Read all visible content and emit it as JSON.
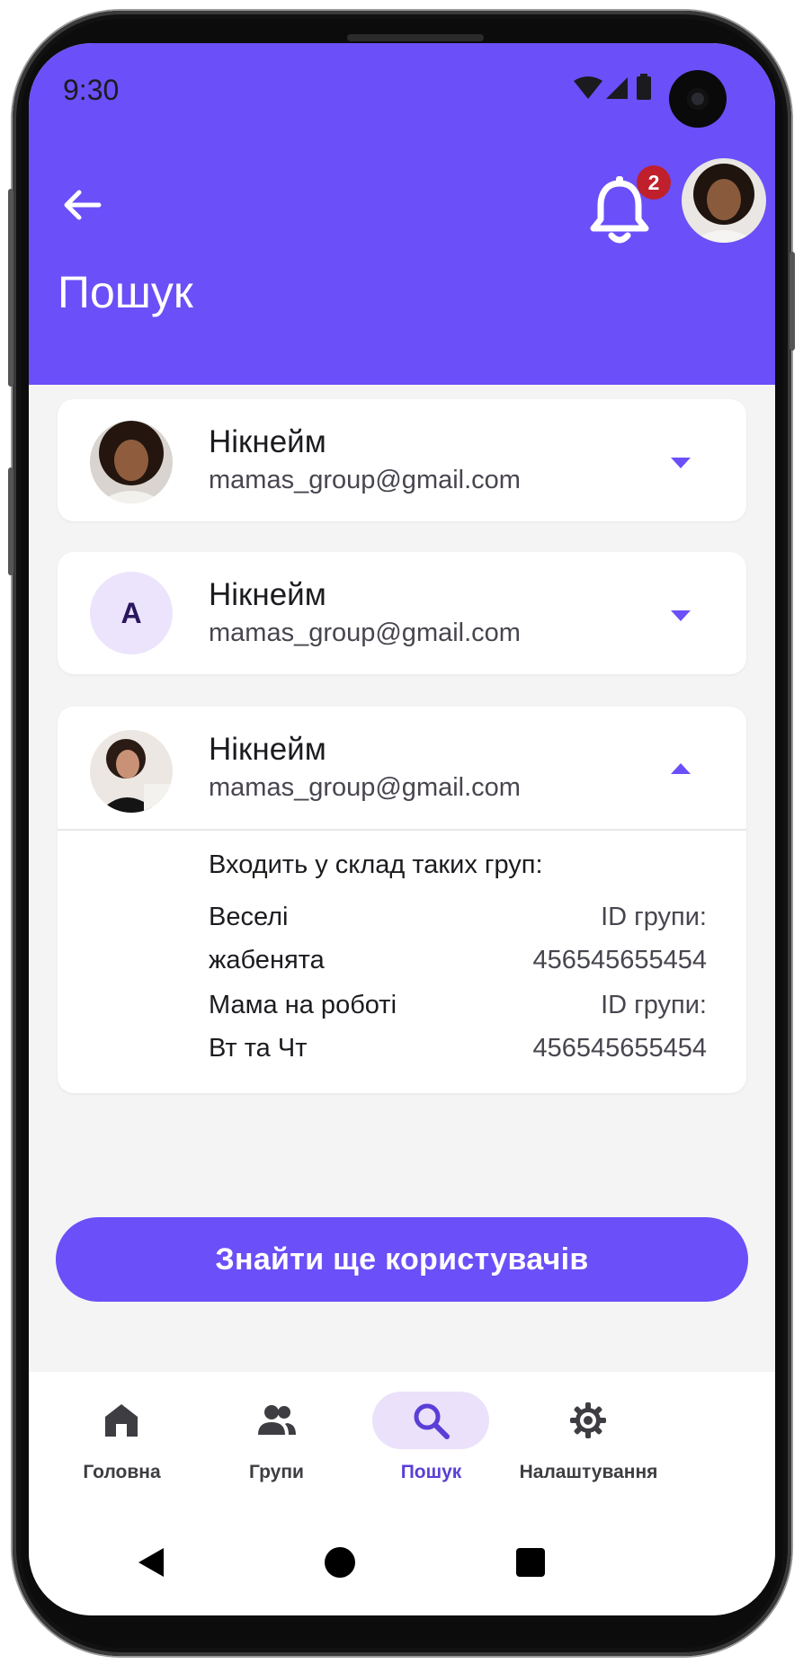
{
  "status_bar": {
    "time": "9:30"
  },
  "header": {
    "title": "Пошук",
    "notification_count": "2"
  },
  "results": [
    {
      "nickname": "Нікнейм",
      "email": "mamas_group@gmail.com",
      "avatar_letter": "",
      "expanded": false
    },
    {
      "nickname": "Нікнейм",
      "email": "mamas_group@gmail.com",
      "avatar_letter": "A",
      "expanded": false
    },
    {
      "nickname": "Нікнейм",
      "email": "mamas_group@gmail.com",
      "avatar_letter": "",
      "expanded": true,
      "groups_title": "Входить у склад таких груп:",
      "groups": [
        {
          "name_line1": "Веселі",
          "name_line2": "жабенята",
          "id_label": "ID групи:",
          "id_value": "456545655454"
        },
        {
          "name_line1": "Мама на роботі",
          "name_line2": "Вт та Чт",
          "id_label": "ID групи:",
          "id_value": "456545655454"
        }
      ]
    }
  ],
  "find_more_button": "Знайти ще користувачів",
  "bottom_nav": [
    {
      "label": "Головна",
      "icon": "home-icon",
      "active": false
    },
    {
      "label": "Групи",
      "icon": "people-icon",
      "active": false
    },
    {
      "label": "Пошук",
      "icon": "search-icon",
      "active": true
    },
    {
      "label": "Налаштування",
      "icon": "gear-icon",
      "active": false
    }
  ],
  "colors": {
    "primary": "#6b4ff8",
    "background": "#f4f4f5",
    "active_nav_pill": "#ebe1fb",
    "badge": "#c0202b"
  }
}
